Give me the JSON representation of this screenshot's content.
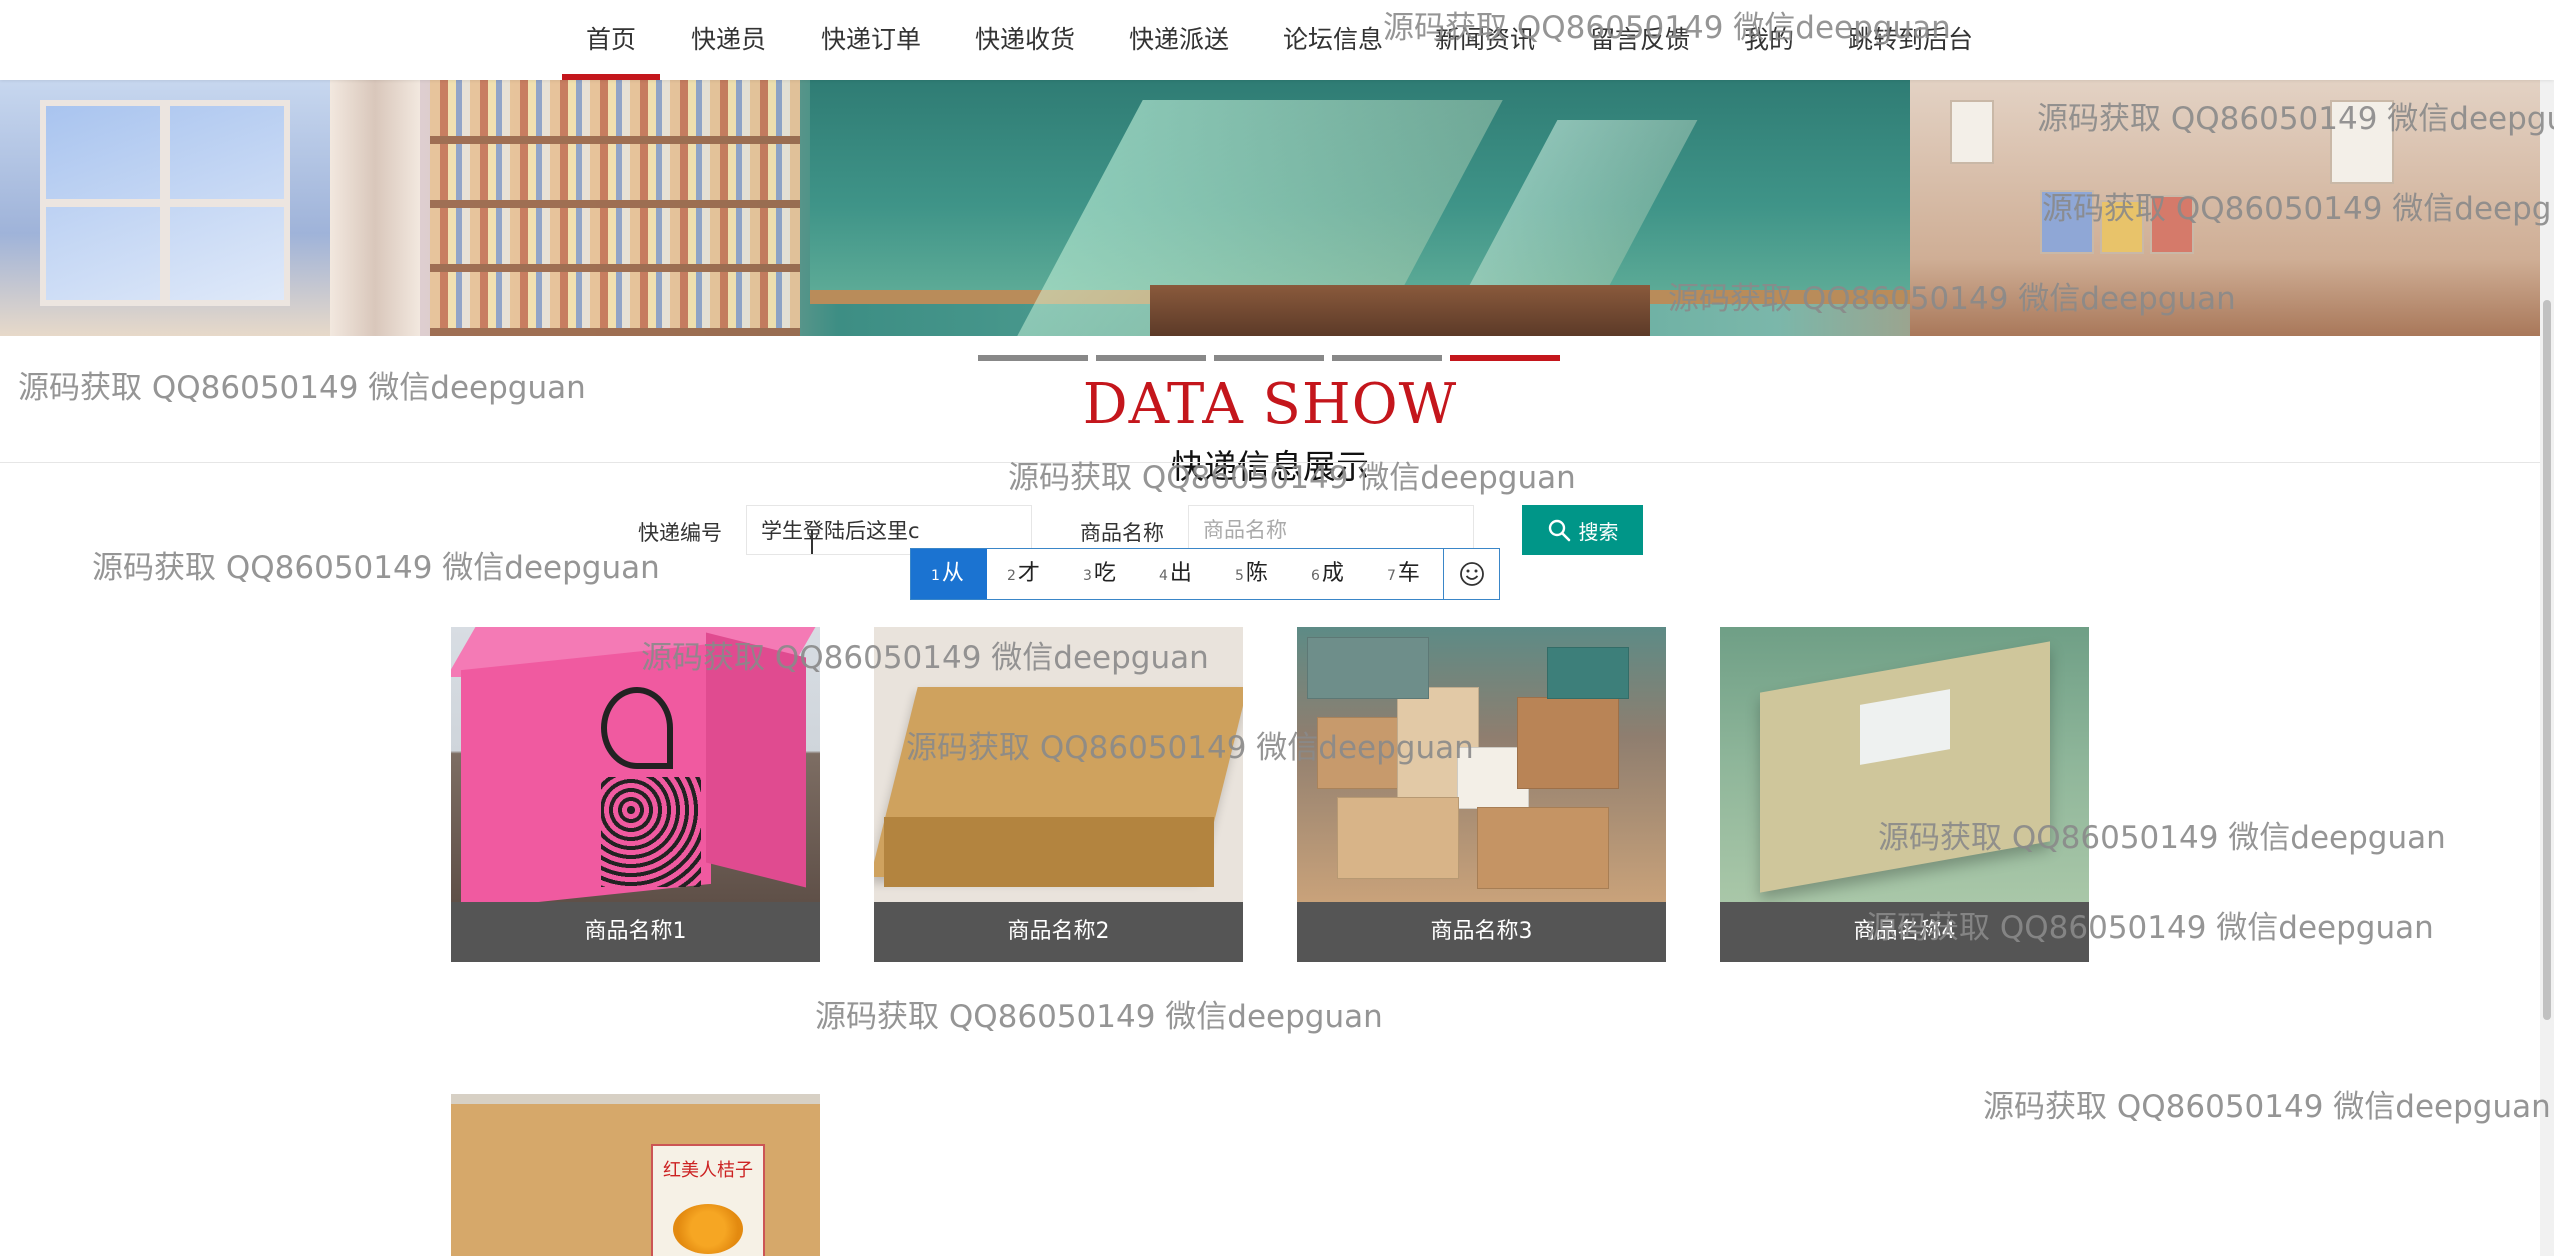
{
  "nav": {
    "items": [
      {
        "label": "首页",
        "active": true
      },
      {
        "label": "快递员"
      },
      {
        "label": "快递订单"
      },
      {
        "label": "快递收货"
      },
      {
        "label": "快递派送"
      },
      {
        "label": "论坛信息"
      },
      {
        "label": "新闻资讯"
      },
      {
        "label": "留言反馈"
      },
      {
        "label": "我的"
      },
      {
        "label": "跳转到后台"
      }
    ],
    "accent_color": "#c4161c"
  },
  "carousel": {
    "slide_count": 5,
    "active_index": 4
  },
  "section": {
    "title_en": "DATA SHOW",
    "title_cn": "快递信息展示"
  },
  "search": {
    "field1_label": "快递编号",
    "field1_value": "学生登陆后这里c",
    "field2_label": "商品名称",
    "field2_placeholder": "商品名称",
    "button_label": "搜索",
    "button_icon": "search-icon",
    "button_color": "#009688"
  },
  "ime": {
    "candidates": [
      {
        "num": "1",
        "text": "从"
      },
      {
        "num": "2",
        "text": "才"
      },
      {
        "num": "3",
        "text": "吃"
      },
      {
        "num": "4",
        "text": "出"
      },
      {
        "num": "5",
        "text": "陈"
      },
      {
        "num": "6",
        "text": "成"
      },
      {
        "num": "7",
        "text": "车"
      }
    ],
    "emoji_icon": "smiley-icon"
  },
  "products": [
    {
      "name": "商品名称1"
    },
    {
      "name": "商品名称2"
    },
    {
      "name": "商品名称3"
    },
    {
      "name": "商品名称4"
    },
    {
      "name": "",
      "sticker_text": "红美人桔子"
    }
  ],
  "watermark": "源码获取 QQ86050149 微信deepguan"
}
